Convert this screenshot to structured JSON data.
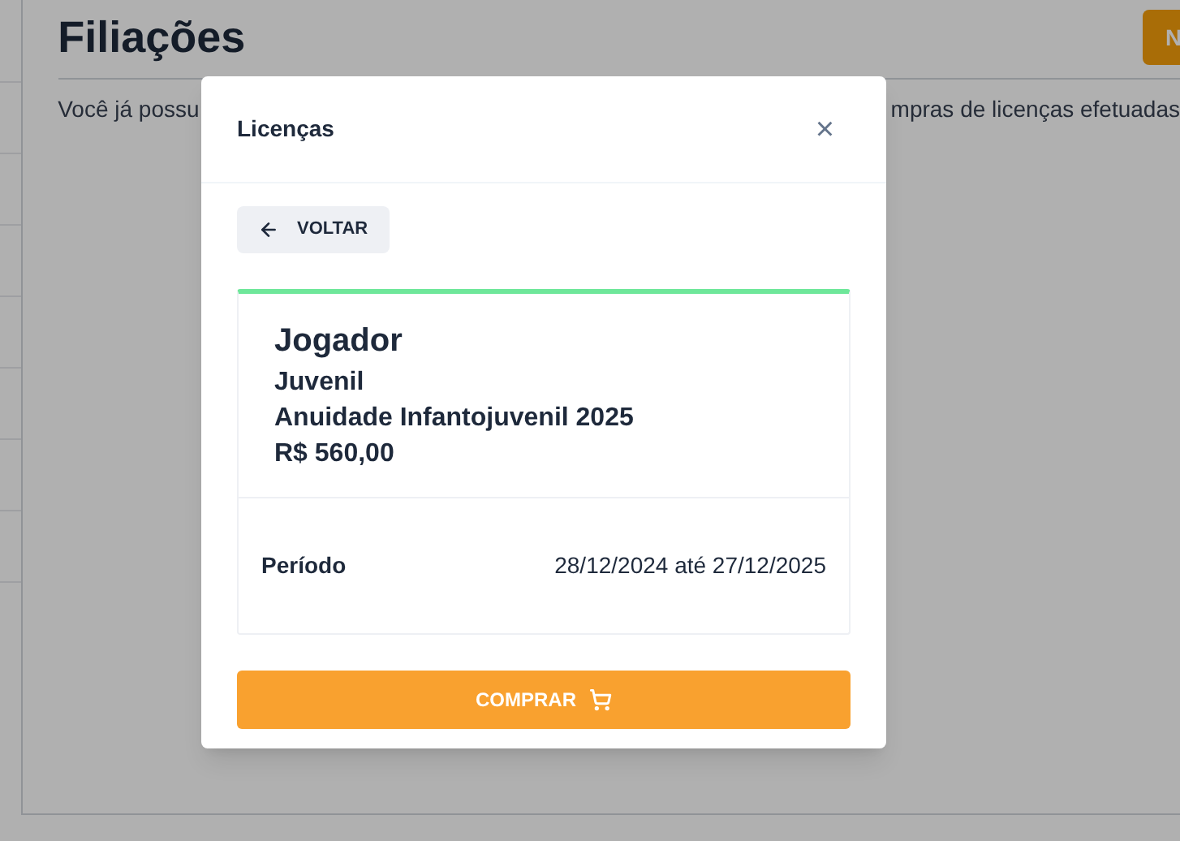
{
  "page": {
    "title": "Filiações",
    "header_button": "N",
    "description_parts": [
      "Você já possu",
      "mpras de licenças efetuadas"
    ]
  },
  "modal": {
    "title": "Licenças",
    "close": "×",
    "back_button": "VOLTAR",
    "license": {
      "category": "Jogador",
      "level": "Juvenil",
      "name": "Anuidade Infantojuvenil 2025",
      "price": "R$ 560,00",
      "period_label": "Período",
      "period_value": "28/12/2024 até 27/12/2025"
    },
    "buy_button": "COMPRAR"
  }
}
